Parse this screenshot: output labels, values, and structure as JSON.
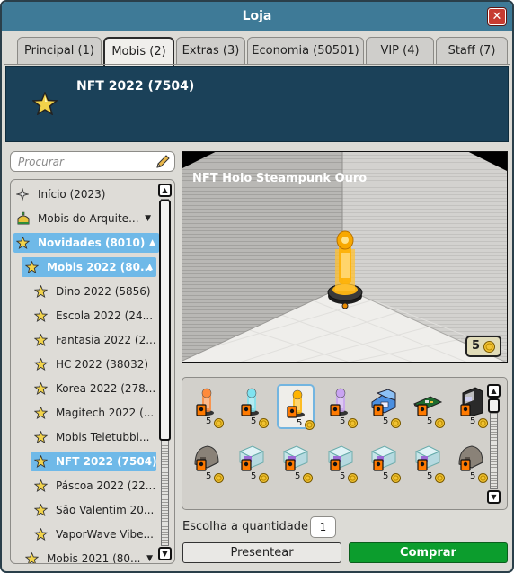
{
  "window": {
    "title": "Loja",
    "close_label": "✕"
  },
  "tabs": [
    {
      "label": "Principal (1)",
      "active": false
    },
    {
      "label": "Mobis (2)",
      "active": true
    },
    {
      "label": "Extras (3)",
      "active": false
    },
    {
      "label": "Economia (50501)",
      "active": false
    },
    {
      "label": "VIP (4)",
      "active": false
    },
    {
      "label": "Staff (7)",
      "active": false
    }
  ],
  "banner": {
    "title": "NFT 2022 (7504)"
  },
  "search": {
    "placeholder": "Procurar"
  },
  "tree": {
    "items": [
      {
        "label": "Início (2023)",
        "icon": "sparkle-icon"
      },
      {
        "label": "Mobis do Arquite...",
        "icon": "architect-icon",
        "arrow": "▼"
      },
      {
        "label": "Novidades (8010)",
        "icon": "star-icon",
        "arrow": "▲",
        "selected": true
      },
      {
        "label": "Mobis 2022 (80...",
        "icon": "star-icon",
        "arrow": "▲",
        "selected": true
      },
      {
        "label": "Dino 2022 (5856)",
        "icon": "star-icon"
      },
      {
        "label": "Escola 2022 (24...",
        "icon": "star-icon"
      },
      {
        "label": "Fantasia 2022 (2...",
        "icon": "star-icon"
      },
      {
        "label": "HC 2022 (38032)",
        "icon": "star-icon"
      },
      {
        "label": "Korea 2022 (278...",
        "icon": "star-icon"
      },
      {
        "label": "Magitech 2022 (...",
        "icon": "star-icon"
      },
      {
        "label": "Mobis Teletubbi...",
        "icon": "star-icon"
      },
      {
        "label": "NFT 2022 (7504)",
        "icon": "star-icon",
        "selected": true
      },
      {
        "label": "Páscoa 2022 (22...",
        "icon": "star-icon"
      },
      {
        "label": "São Valentim 20...",
        "icon": "star-icon"
      },
      {
        "label": "VaporWave Vibe...",
        "icon": "star-icon"
      },
      {
        "label": "Mobis 2021 (80...",
        "icon": "star-icon",
        "arrow": "▼"
      }
    ]
  },
  "preview": {
    "title": "NFT Holo Steampunk Ouro",
    "price": "5"
  },
  "grid": {
    "items": [
      {
        "qty": "5",
        "icon": "holo-orange-icon"
      },
      {
        "qty": "5",
        "icon": "holo-cyan-icon"
      },
      {
        "qty": "5",
        "icon": "holo-gold-icon",
        "selected": true
      },
      {
        "qty": "5",
        "icon": "holo-purple-icon"
      },
      {
        "qty": "5",
        "icon": "blue-chair-icon"
      },
      {
        "qty": "5",
        "icon": "circuit-board-icon"
      },
      {
        "qty": "5",
        "icon": "arcade-machine-icon"
      },
      {
        "qty": "5",
        "icon": "dome-icon"
      },
      {
        "qty": "5",
        "icon": "glass-case-icon"
      },
      {
        "qty": "5",
        "icon": "glass-case-icon"
      },
      {
        "qty": "5",
        "icon": "glass-case-icon"
      },
      {
        "qty": "5",
        "icon": "glass-case-icon"
      },
      {
        "qty": "5",
        "icon": "glass-case-icon"
      },
      {
        "qty": "5",
        "icon": "dome-icon"
      }
    ]
  },
  "quantity": {
    "label": "Escolha a quantidade",
    "value": "1"
  },
  "buttons": {
    "gift": "Presentear",
    "buy": "Comprar"
  },
  "colors": {
    "accent": "#3e7a97",
    "banner": "#1b4159",
    "selected": "#6fb9e8",
    "buy": "#0c9d2d"
  }
}
